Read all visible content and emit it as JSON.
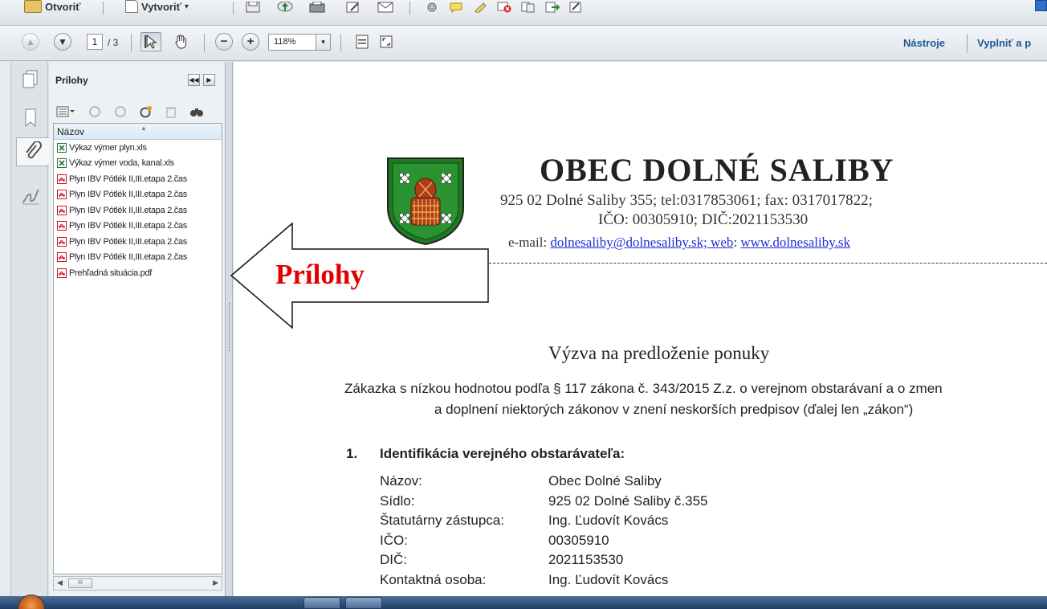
{
  "toolbar_top": {
    "open_label": "Otvoriť",
    "create_label": "Vytvoriť",
    "create_caret": "▾"
  },
  "toolbar_nav": {
    "current_page": "1",
    "total_pages": "/ 3",
    "zoom_value": "118%",
    "zoom_caret": "▾",
    "tools_link": "Nástroje",
    "fill_sign_link": "Vyplniť a p"
  },
  "attachments_panel": {
    "title": "Prílohy",
    "column_header": "Názov",
    "files": [
      {
        "name": "Výkaz výmer plyn.xls",
        "type": "xls"
      },
      {
        "name": "Výkaz výmer voda, kanal.xls",
        "type": "xls"
      },
      {
        "name": "Plyn IBV Pótlék II,III.etapa 2.čas",
        "type": "pdf"
      },
      {
        "name": "Plyn IBV Pótlék II,III.etapa 2.čas",
        "type": "pdf"
      },
      {
        "name": "Plyn IBV Pótlék II,III.etapa 2.čas",
        "type": "pdf"
      },
      {
        "name": "Plyn IBV Pótlék II,III.etapa 2.čas",
        "type": "pdf"
      },
      {
        "name": "Plyn IBV Pótlék II,III.etapa 2.čas",
        "type": "pdf"
      },
      {
        "name": "Plyn IBV Pótlék II,III.etapa 2.čas",
        "type": "pdf"
      },
      {
        "name": "Prehľadná situácia.pdf",
        "type": "pdf"
      }
    ],
    "scroll_thumb": "III"
  },
  "annotation": {
    "arrow_label": "Prílohy",
    "arrow_label_color": "#e00000"
  },
  "document": {
    "org_name": "OBEC DOLNÉ   SALIBY",
    "address": "925 02 Dolné Saliby 355; tel:0317853061; fax: 0317017822;",
    "ico_dic": "IČO: 00305910;  DIČ:2021153530",
    "email_prefix": "e-mail: ",
    "email_link": "dolnesaliby@dolnesaliby.sk; web",
    "web_sep": ": ",
    "web_link": "www.dolnesaliby.sk",
    "title": "Výzva na predloženie ponuky",
    "subtitle_line1": "Zákazka s nízkou hodnotou podľa § 117 zákona č. 343/2015 Z.z. o verejnom obstarávaní a o zmen",
    "subtitle_line2": "a doplnení niektorých zákonov v znení neskorších predpisov (ďalej len „zákon“)",
    "section1_number": "1.",
    "section1_title": "Identifikácia verejného obstarávateľa:",
    "details": [
      {
        "label": "Názov:",
        "value": "Obec Dolné Saliby"
      },
      {
        "label": "Sídlo:",
        "value": "925 02 Dolné Saliby č.355"
      },
      {
        "label": "Štatutárny zástupca:",
        "value": "Ing. Ľudovít Kovács"
      },
      {
        "label": "IČO:",
        "value": "00305910"
      },
      {
        "label": "DIČ:",
        "value": "2021153530"
      },
      {
        "label": "Kontaktná osoba:",
        "value": "Ing. Ľudovít Kovács"
      }
    ]
  },
  "colors": {
    "link_blue": "#1d2fd6",
    "tools_blue": "#1a5a99",
    "coat_green": "#1e7a22",
    "pdf_red": "#c8141e",
    "xls_green": "#1d7a3a"
  }
}
